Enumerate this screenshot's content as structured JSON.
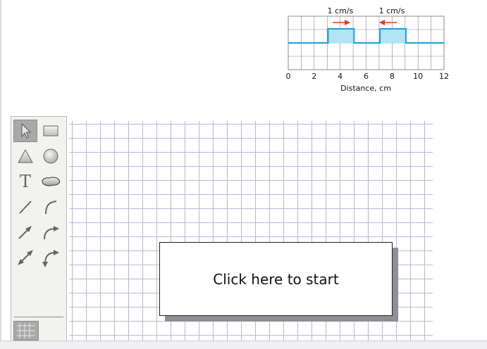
{
  "figure": {
    "speed_label_left": "1 cm/s",
    "speed_label_right": "1 cm/s",
    "axis_label": "Distance, cm",
    "ticks": [
      "0",
      "2",
      "4",
      "6",
      "8",
      "10",
      "12"
    ],
    "colors": {
      "pulse_fill": "#b3e4f5",
      "pulse_line": "#1aa0de",
      "arrow": "#e33a2c",
      "grid": "#8a8a8a"
    }
  },
  "toolbox": {
    "tools": [
      {
        "id": "select",
        "icon": "arrow-cursor-icon",
        "selected": true
      },
      {
        "id": "rectangle",
        "icon": "rectangle-icon"
      },
      {
        "id": "triangle",
        "icon": "triangle-icon"
      },
      {
        "id": "circle",
        "icon": "circle-icon"
      },
      {
        "id": "text",
        "icon": "text-icon"
      },
      {
        "id": "blob",
        "icon": "freeform-shape-icon"
      },
      {
        "id": "line",
        "icon": "line-icon"
      },
      {
        "id": "curve",
        "icon": "curve-icon"
      },
      {
        "id": "arrow",
        "icon": "arrow-icon"
      },
      {
        "id": "curved-arrow",
        "icon": "curved-arrow-icon"
      },
      {
        "id": "double-arrow",
        "icon": "double-arrow-icon"
      },
      {
        "id": "curved-double-arrow",
        "icon": "curved-double-arrow-icon"
      },
      {
        "id": "grid-toggle",
        "icon": "grid-icon"
      }
    ],
    "text_tool_glyph": "T"
  },
  "canvas": {
    "grid_color": "#b9b9d2",
    "start_label": "Click here to start"
  }
}
